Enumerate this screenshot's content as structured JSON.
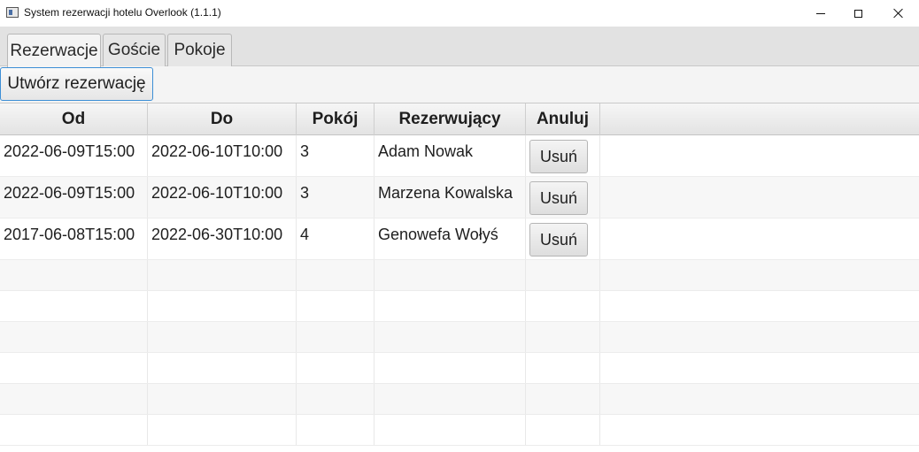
{
  "window": {
    "title": "System rezerwacji hotelu Overlook (1.1.1)",
    "controls": [
      "minimize-icon",
      "maximize-icon",
      "close-icon"
    ]
  },
  "tabs": [
    {
      "label": "Rezerwacje",
      "active": true
    },
    {
      "label": "Goście",
      "active": false
    },
    {
      "label": "Pokoje",
      "active": false
    }
  ],
  "toolbar": {
    "create_label": "Utwórz rezerwację",
    "focus_color": "#3d8fd6"
  },
  "table": {
    "columns": [
      "Od",
      "Do",
      "Pokój",
      "Rezerwujący",
      "Anuluj"
    ],
    "rows": [
      {
        "od": "2022-06-09T15:00",
        "do": "2022-06-10T10:00",
        "pokoj": "3",
        "rezerwujacy": "Adam Nowak",
        "action": "Usuń"
      },
      {
        "od": "2022-06-09T15:00",
        "do": "2022-06-10T10:00",
        "pokoj": "3",
        "rezerwujacy": "Marzena Kowalska",
        "action": "Usuń"
      },
      {
        "od": "2017-06-08T15:00",
        "do": "2022-06-30T10:00",
        "pokoj": "4",
        "rezerwujacy": "Genowefa Wołyś",
        "action": "Usuń"
      }
    ]
  }
}
